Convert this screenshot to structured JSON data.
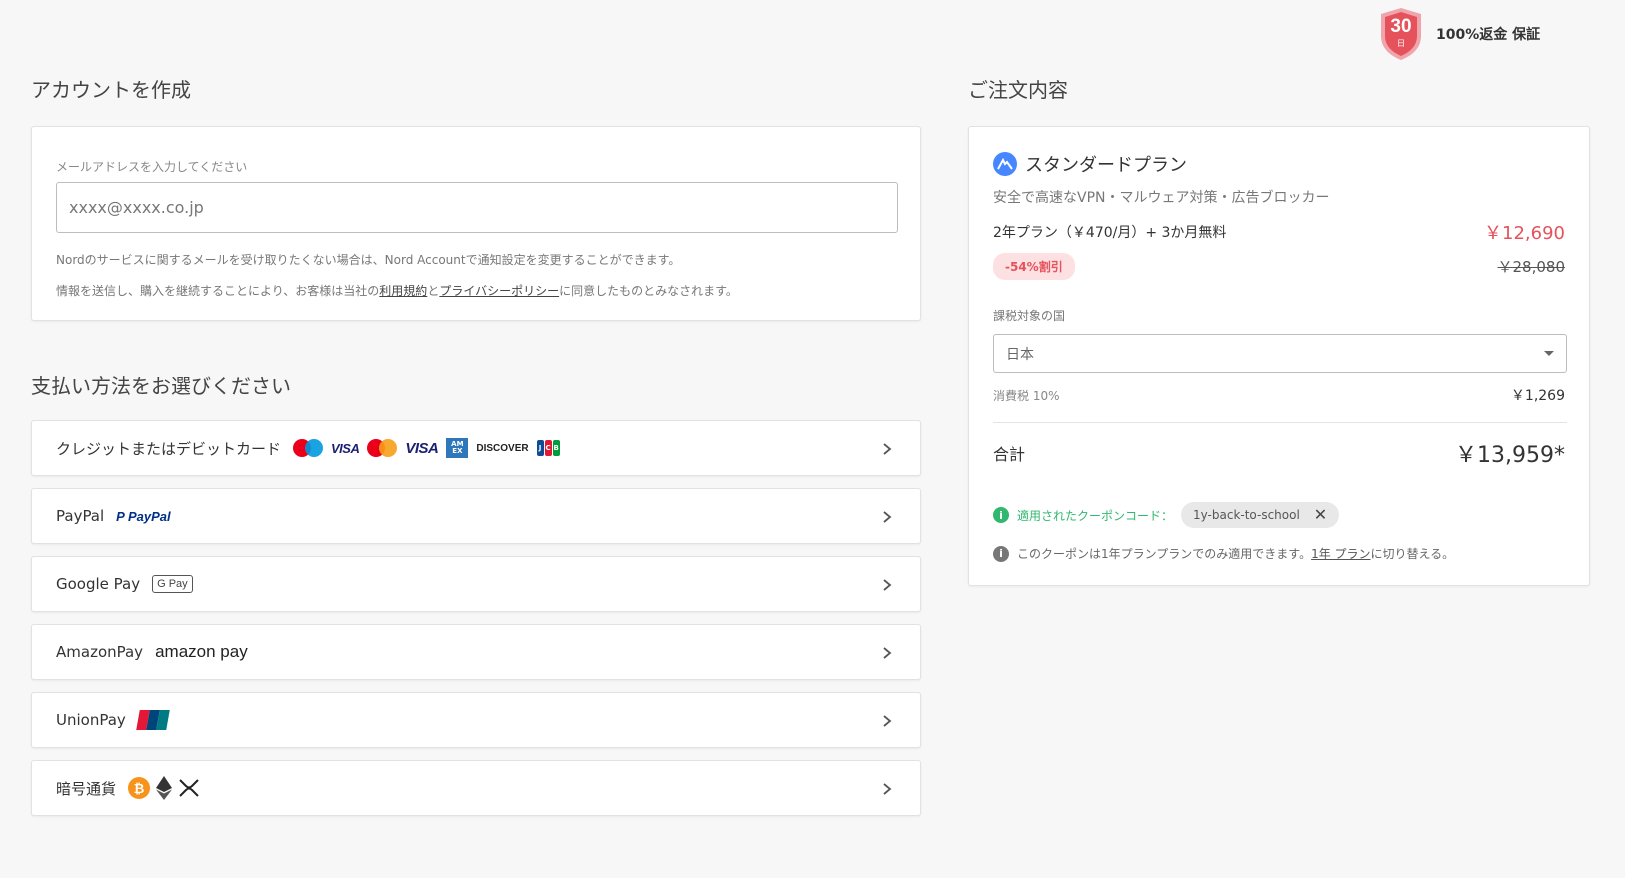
{
  "guarantee": {
    "days": "30",
    "day_unit": "日",
    "text": "100%返金 保証"
  },
  "account": {
    "title": "アカウントを作成",
    "email_label": "メールアドレスを入力してください",
    "email_placeholder": "xxxx@xxxx.co.jp",
    "note1": "Nordのサービスに関するメールを受け取りたくない場合は、Nord Accountで通知設定を変更することができます。",
    "note2_before": "情報を送信し、購入を継続することにより、お客様は当社の",
    "terms_link": "利用規約",
    "note2_and": "と",
    "privacy_link": "プライバシーポリシー",
    "note2_after": "に同意したものとみなされます。"
  },
  "payment": {
    "title": "支払い方法をお選びください",
    "methods": [
      {
        "label": "クレジットまたはデビットカード"
      },
      {
        "label": "PayPal",
        "logo_text": "PayPal"
      },
      {
        "label": "Google Pay",
        "logo_text": "G Pay"
      },
      {
        "label": "AmazonPay",
        "logo_text": "amazon pay"
      },
      {
        "label": "UnionPay"
      },
      {
        "label": "暗号通貨"
      }
    ],
    "card_logos": {
      "visa": "VISA",
      "amex": "AM EX",
      "discover": "DISCOVER",
      "jcb": "JCB"
    }
  },
  "order": {
    "title": "ご注文内容",
    "plan_name": "スタンダードプラン",
    "plan_desc": "安全で高速なVPN・マルウェア対策・広告ブロッカー",
    "plan_line": "2年プラン（￥470/月）+ 3か月無料",
    "plan_price": "￥12,690",
    "discount_badge": "-54%割引",
    "original_price": "￥28,080",
    "tax_country_label": "課税対象の国",
    "country_selected": "日本",
    "tax_label": "消費税 10%",
    "tax_value": "￥1,269",
    "total_label": "合計",
    "total_value": "￥13,959*",
    "coupon_label": "適用されたクーポンコード：",
    "coupon_code": "1y-back-to-school",
    "coupon_note_before": "このクーポンは1年プランプランでのみ適用できます。",
    "coupon_note_link": "1年 プラン",
    "coupon_note_after": "に切り替える。"
  },
  "colors": {
    "accent_red": "#e5525c",
    "success_green": "#2fb86e",
    "brand_blue": "#4687ff"
  }
}
